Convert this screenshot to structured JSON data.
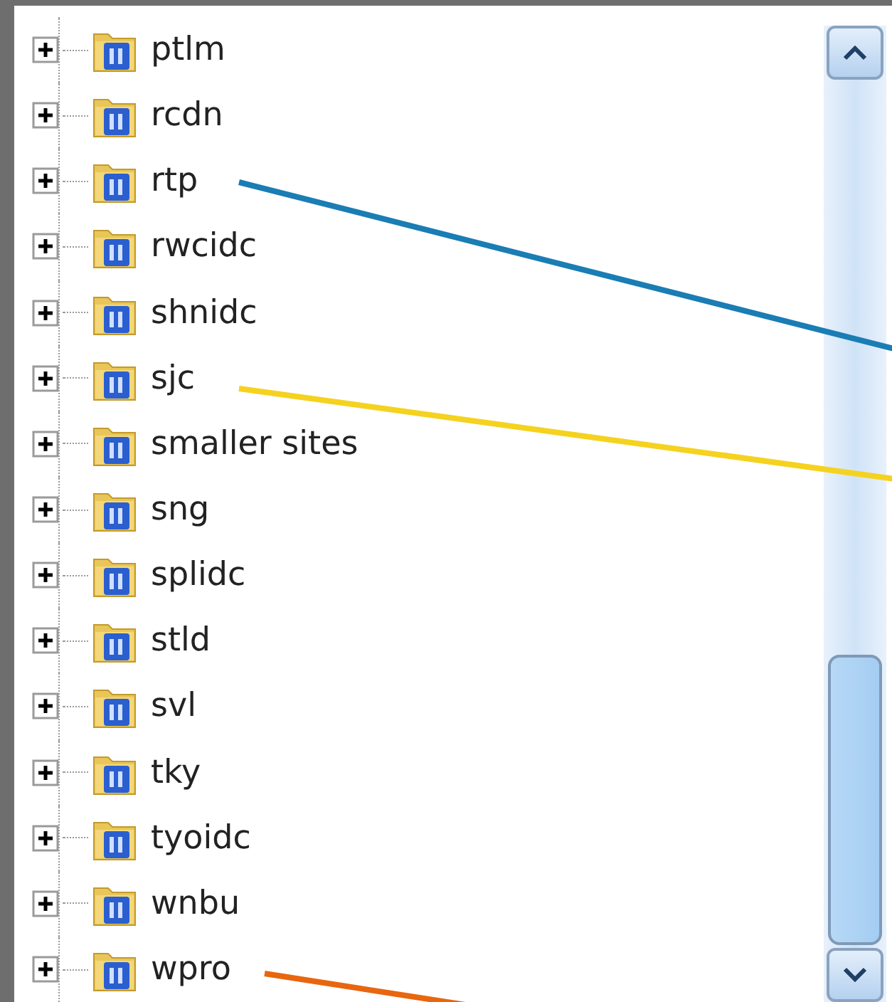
{
  "tree": {
    "items": [
      {
        "label": "ptlm",
        "expanded": false
      },
      {
        "label": "rcdn",
        "expanded": false
      },
      {
        "label": "rtp",
        "expanded": false
      },
      {
        "label": "rwcidc",
        "expanded": false
      },
      {
        "label": "shnidc",
        "expanded": false
      },
      {
        "label": "sjc",
        "expanded": false
      },
      {
        "label": "smaller sites",
        "expanded": false
      },
      {
        "label": "sng",
        "expanded": false
      },
      {
        "label": "splidc",
        "expanded": false
      },
      {
        "label": "stld",
        "expanded": false
      },
      {
        "label": "svl",
        "expanded": false
      },
      {
        "label": "tky",
        "expanded": false
      },
      {
        "label": "tyoidc",
        "expanded": false
      },
      {
        "label": "wnbu",
        "expanded": false
      },
      {
        "label": "wpro",
        "expanded": false
      }
    ]
  },
  "leader_lines": [
    {
      "color": "#1a7db3"
    },
    {
      "color": "#f5d21f"
    },
    {
      "color": "#e8660f"
    }
  ]
}
